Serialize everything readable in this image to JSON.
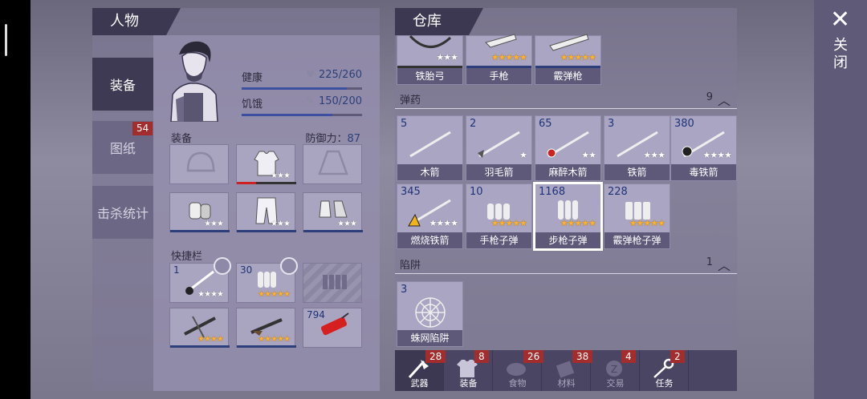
{
  "character": {
    "header": "人物",
    "tabs": [
      {
        "label": "装备"
      },
      {
        "label": "图纸",
        "badge": "54"
      },
      {
        "label": "击杀统计"
      }
    ],
    "stats": [
      {
        "label": "健康",
        "value": "225/260",
        "fraction": 0.87,
        "icon": "heart-icon"
      },
      {
        "label": "饥饿",
        "value": "150/200",
        "fraction": 0.75,
        "icon": "drumstick-icon"
      }
    ],
    "equip_label": "装备",
    "defense_label": "防御力：",
    "defense_value": "87",
    "quickbar_label": "快捷栏",
    "quickbar_counts": [
      "1",
      "30",
      "794"
    ]
  },
  "warehouse": {
    "header": "仓库",
    "weapons": [
      "铁胎弓",
      "手枪",
      "霰弹枪"
    ],
    "ammo_category": {
      "title": "弹药",
      "count": "9"
    },
    "ammo": [
      {
        "name": "木箭",
        "count": "5",
        "stars": ""
      },
      {
        "name": "羽毛箭",
        "count": "2",
        "stars": "★"
      },
      {
        "name": "麻醉木箭",
        "count": "65",
        "stars": "★★"
      },
      {
        "name": "铁箭",
        "count": "3",
        "stars": "★★★"
      },
      {
        "name": "毒铁箭",
        "count": "380",
        "stars": "★★★★"
      },
      {
        "name": "燃烧铁箭",
        "count": "345",
        "stars": "★★★★"
      },
      {
        "name": "手枪子弹",
        "count": "10",
        "stars": "★★★★★"
      },
      {
        "name": "步枪子弹",
        "count": "1168",
        "stars": "★★★★★"
      },
      {
        "name": "霰弹枪子弹",
        "count": "228",
        "stars": "★★★★★"
      }
    ],
    "trap_category": {
      "title": "陷阱",
      "count": "1"
    },
    "traps": [
      {
        "name": "蛛网陷阱",
        "count": "3"
      }
    ],
    "bottom_tabs": [
      {
        "label": "武器",
        "badge": "28",
        "icon": "axe-icon"
      },
      {
        "label": "装备",
        "badge": "8",
        "icon": "shirt-icon"
      },
      {
        "label": "食物",
        "badge": "26",
        "icon": "food-icon"
      },
      {
        "label": "材料",
        "badge": "38",
        "icon": "material-icon"
      },
      {
        "label": "交易",
        "badge": "4",
        "icon": "trade-icon"
      },
      {
        "label": "任务",
        "badge": "2",
        "icon": "key-icon"
      }
    ]
  },
  "close": {
    "label": "关闭",
    "icon": "close-icon"
  },
  "colors": {
    "accent_blue": "#3d4fa0",
    "badge_red": "#a32c2c",
    "star_gold": "#ffb12a"
  }
}
